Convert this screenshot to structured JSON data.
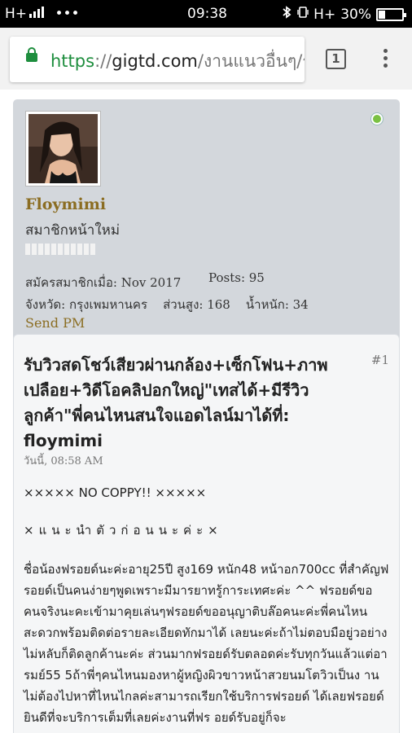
{
  "status_bar": {
    "carrier_label": "H+",
    "more_label": "•••",
    "time": "09:38",
    "bluetooth_icon": "bluetooth-icon",
    "vibrate_icon": "vibrate-icon",
    "network_label": "H+",
    "battery_percent": "30%",
    "battery_level": 0.3
  },
  "browser": {
    "url_scheme": "https",
    "url_separator": "://",
    "url_host": "gigtd.com",
    "url_path": "/งานแนวอื่นๆ/รั",
    "tab_count": "1",
    "menu_icon": "overflow-menu-icon",
    "lock_color": "#1e8e3e"
  },
  "profile": {
    "username": "Floymimi",
    "user_title": "สมาชิกหน้าใหม่",
    "joined": "สมัครสมาชิกเมื่อ: Nov 2017",
    "posts": "Posts: 95",
    "location": "จังหวัด: กรุงเพมหานคร    ส่วนสูง: 168    น้ำหนัก: 34",
    "send_pm": "Send PM",
    "online_color": "#7ac143",
    "name_color": "#8b6d22"
  },
  "post": {
    "number": "#1",
    "title": "รับวิวสดโชว์เสียวผ่านกล้อง+เซ็กโฟน+ภาพเปลือย+วิดีโอคลิปอกใหญ่\"เทสได้+มีรีวิวลูกค้า\"พี่คนไหนสนใจแอดไลน์มาได้ที่: floymimi",
    "date": "วันนี้, 08:58 AM",
    "line1": "××××× NO COPPY!! ×××××",
    "line2": "×แนะนำตัวก่อนนะค่ะ×",
    "paragraph": "ชื่อน้องฟรอยด์นะค่ะอายุ25ปี สูง169 หนัก48 หน้าอก700cc ที่สำคัญฟรอยด์เป็นคนง่ายๆพูดเพราะมีมารยาทรู้การะเทศะค่ะ ^^ ฟรอยด์ขอคนจริงนะคะเข้ามาคุยเล่นๆฟรอยด์ขออนุญาติบล๊อคนะค่ะพี่คนไหนสะดวกพร้อมติดต่อรายละเอียดทักมาได้ เลยนะค่ะถ้าไม่ตอบมือยู่วอย่างไม่หลับก็ติดลูกค้านะค่ะ ส่วนมากฟรอยด์รับตลอดค่ะรับทุกวันแล้วแต่อารมย์55 5ถ้าพี่ๆคนไหนมองหาผู้หญิงผิวขาวหน้าสวยนมโตวิวเป็นง านไม่ต้องไปหาที่ไหนไกลค่ะสามารถเรียกใช้บริการฟรอยด์ ได้เลยฟรอยด์ยินดีที่จะบริการเต็มที่เลยค่ะงานที่ฟร อยด์รับอยู่ก็จะ"
  }
}
